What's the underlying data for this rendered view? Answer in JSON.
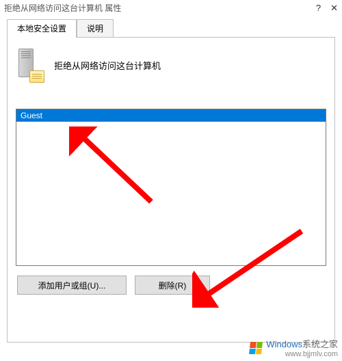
{
  "titlebar": {
    "title": "拒绝从网络访问这台计算机 属性",
    "help": "?",
    "close": "✕"
  },
  "tabs": {
    "local_security": "本地安全设置",
    "explain": "说明"
  },
  "policy": {
    "icon_name": "server-policy-icon",
    "title": "拒绝从网络访问这台计算机"
  },
  "list": {
    "items": [
      {
        "label": "Guest",
        "selected": true
      }
    ]
  },
  "buttons": {
    "add": "添加用户或组(U)...",
    "remove": "删除(R)"
  },
  "watermark": {
    "brand_prefix": "Windows",
    "brand_suffix": "系统之家",
    "url": "www.bjjmlv.com"
  },
  "annotations": {
    "arrow_color": "#ff0000"
  }
}
